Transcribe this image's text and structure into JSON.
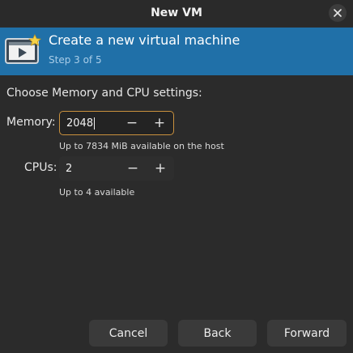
{
  "window": {
    "title": "New VM"
  },
  "banner": {
    "heading": "Create a new virtual machine",
    "step": "Step 3 of 5",
    "icon": "vm-monitor-icon"
  },
  "section": {
    "title": "Choose Memory and CPU settings:"
  },
  "memory": {
    "label": "Memory:",
    "value": "2048",
    "decrement": "−",
    "increment": "+",
    "hint": "Up to 7834 MiB available on the host"
  },
  "cpus": {
    "label": "CPUs:",
    "value": "2",
    "decrement": "−",
    "increment": "+",
    "hint": "Up to 4 available"
  },
  "footer": {
    "cancel": "Cancel",
    "back": "Back",
    "forward": "Forward"
  },
  "colors": {
    "banner": "#2070a8",
    "focus_ring": "#c9913e",
    "background": "#2b2b2b"
  }
}
